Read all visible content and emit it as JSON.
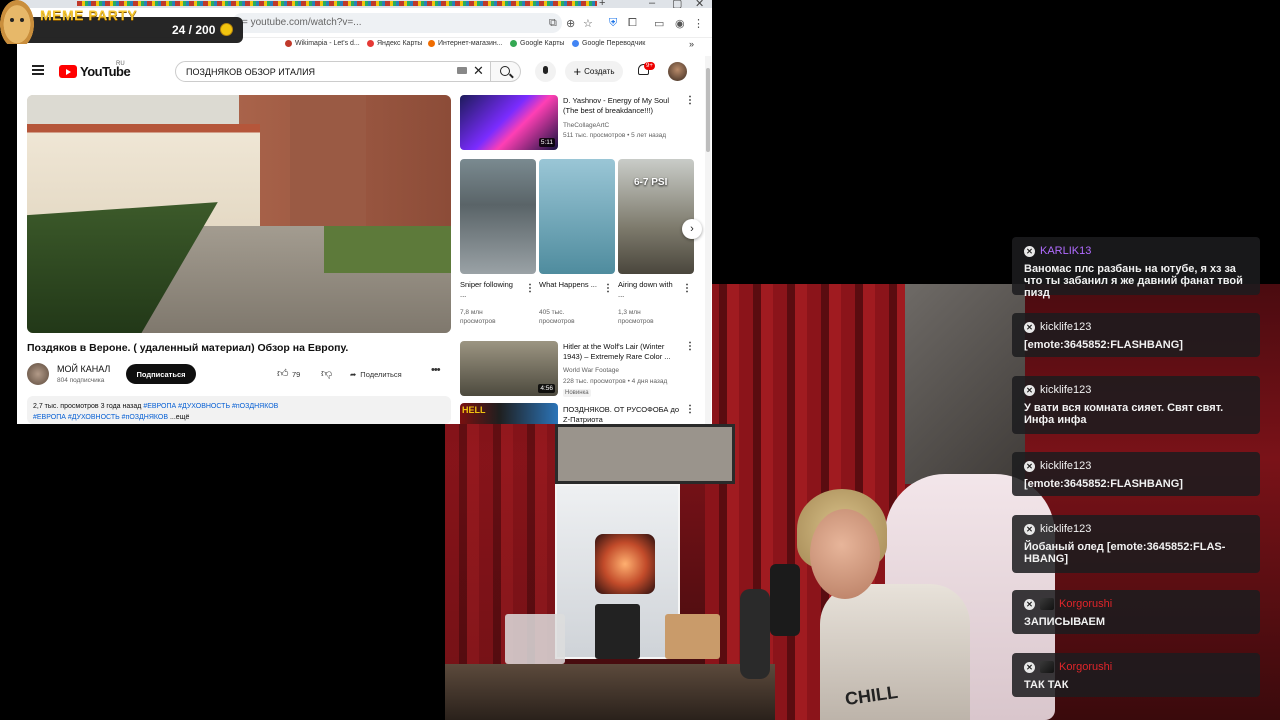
{
  "overlay": {
    "title": "MEME PARTY",
    "counter": "24 / 200"
  },
  "browser": {
    "address_hint": "= youtube.com/watch?v=...",
    "bookmarks": [
      "Wikimapia - Let's d...",
      "Яндекс Карты",
      "Интернет-магазин...",
      "Google Карты",
      "Google Переводчик"
    ],
    "bookmark_colors": [
      "#c0392b",
      "#e53935",
      "#ef6c00",
      "#34a853",
      "#4285f4"
    ]
  },
  "youtube": {
    "logo": "YouTube",
    "region": "RU",
    "search_query": "ПОЗДНЯКОВ ОБЗОР ИТАЛИЯ",
    "create_label": "Создать",
    "notif_badge": "9+",
    "video": {
      "title": "Поздяков в Вероне. ( удаленный материал) Обзор на Европу.",
      "channel": "МОЙ КАНАЛ",
      "subscribers": "804 подписчика",
      "subscribe_label": "Подписаться",
      "likes": "79",
      "share_label": "Поделиться",
      "desc_stats": "2,7 тыс. просмотров  3 года назад",
      "desc_tags_1": "#ЕВРОПА #ДУХОВНОСТЬ #пОЗДНЯКОВ",
      "desc_tags_2": "#ЕВРОПА #ДУХОВНОСТЬ #пОЗДНЯКОВ",
      "desc_more": "...ещё"
    },
    "sidebar": {
      "top": {
        "title": "D. Yashnov - Energy of My Soul (The best of breakdance!!!)",
        "channel": "TheCollageArtC",
        "meta": "511 тыс. просмотров • 5 лет назад",
        "duration": "5:11"
      },
      "shorts": [
        {
          "title": "Sniper following ...",
          "views": "7,8 млн просмотров",
          "overlay": ""
        },
        {
          "title": "What Happens ...",
          "views": "405 тыс. просмотров",
          "overlay": ""
        },
        {
          "title": "Airing down with ...",
          "views": "1,3 млн просмотров",
          "overlay": "6-7 PSI"
        }
      ],
      "item2": {
        "title": "Hitler at the Wolf's Lair (Winter 1943) – Extremely Rare Color ...",
        "channel": "World War Footage",
        "meta": "228 тыс. просмотров • 4 дня назад",
        "badge": "Новинка",
        "duration": "4:56"
      },
      "item3": {
        "title": "ПОЗДНЯКОВ. ОТ РУСОФОБА до Z-Патриота",
        "thumb_text": "HELL"
      }
    }
  },
  "chat": [
    {
      "user": "KARLIK13",
      "color": "#b06bff",
      "text": "Ваномас плс разбань на ютубе, я хз за что ты забанил я же давний фанат твой пизд"
    },
    {
      "user": "kicklife123",
      "color": "#f1f1f1",
      "text": "[emote:3645852:FLASHBANG]"
    },
    {
      "user": "kicklife123",
      "color": "#f1f1f1",
      "text": "У вати вся комната сияет. Свят свят. Инфа инфа"
    },
    {
      "user": "kicklife123",
      "color": "#f1f1f1",
      "text": "[emote:3645852:FLASHBANG]"
    },
    {
      "user": "kicklife123",
      "color": "#f1f1f1",
      "text": "Йобаный олед [emote:3645852:FLAS-HBANG]"
    },
    {
      "user": "Korgorushi",
      "color": "#e0252a",
      "text": "ЗАПИСЫВАЕМ"
    },
    {
      "user": "Korgorushi",
      "color": "#e0252a",
      "text": "ТАК ТАК"
    }
  ],
  "webcam": {
    "shirt_text": "CHILL"
  }
}
